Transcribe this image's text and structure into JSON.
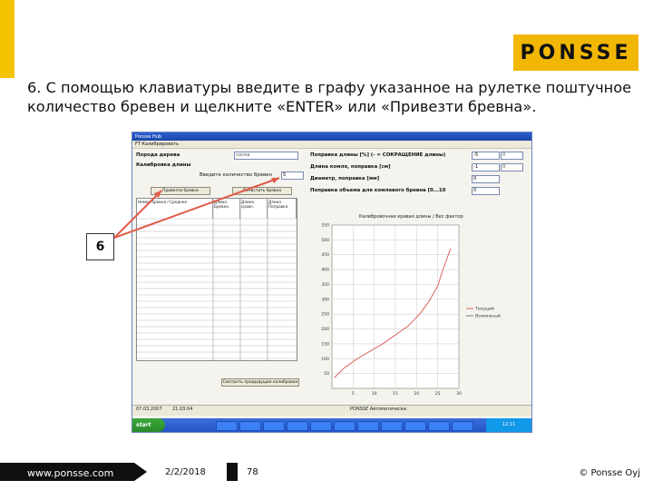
{
  "brand": {
    "logo_text": "PONSSE",
    "yellow": "#f2b705"
  },
  "instruction": "6. С помощью клавиатуры введите в графу указанное на рулетке поштучное количество бревен и щелкните «ENTER» или «Привезти бревна».",
  "callout_number": "6",
  "app": {
    "title": "Ponsse Hub",
    "menu": "FT  Калибрировать",
    "species_label": "Порода дерева",
    "species_value": "сосна",
    "calibration_label": "Калибровка длины",
    "count_prompt": "Введите количество бревен",
    "count_value": "5",
    "fetch_logs_button": "Привезти бревна",
    "clear_button": "Почистить бревна",
    "length_correction_label": "Поправка длины [%] (- = СОКРАЩЕНИЕ длины)",
    "length_correction_value": "-5",
    "length_correction_extra": "0",
    "butt_length_label": "Длина комля, поправка [см]",
    "butt_length_value": "-1",
    "butt_length_extra": "0",
    "diameter_label": "Диаметр, поправка [мм]",
    "diameter_value": "0",
    "volume_label": "Поправка объема для комлевого бревна [0...10",
    "volume_value": "0",
    "grid_headers": [
      "Номер бревна / Среднее",
      "Длина Бревна",
      "Длина сравн.",
      "Длина Поправка",
      "Длина Измерено"
    ],
    "history_button": "Смотреть предыдущие калибровки",
    "status": {
      "left": "07.03.2007",
      "mid": "21.03.04",
      "right": "PONSSE  Автоматически"
    },
    "taskbar_start": "start",
    "clock": "12:11"
  },
  "chart_data": {
    "type": "line",
    "title": "Калибровочная кривая длины / Вес фактор",
    "xlim": [
      0,
      30
    ],
    "ylim": [
      0,
      550
    ],
    "x_ticks": [
      "5",
      "10",
      "15",
      "20",
      "25",
      "30"
    ],
    "y_ticks": [
      "50",
      "100",
      "150",
      "200",
      "250",
      "300",
      "350",
      "400",
      "450",
      "500",
      "550"
    ],
    "legend": [
      "Текущий",
      "Возможный"
    ],
    "legend_position": "right",
    "series": [
      {
        "name": "Текущий",
        "color": "#d9534f",
        "x": [
          0.5,
          3,
          6,
          9,
          12,
          15,
          18,
          21,
          23,
          25,
          26,
          27,
          28
        ],
        "y": [
          35,
          70,
          100,
          125,
          150,
          180,
          210,
          255,
          295,
          345,
          390,
          430,
          470
        ]
      }
    ],
    "grid": true
  },
  "footer": {
    "site": "www.ponsse.com",
    "date": "2/2/2018",
    "page": "78",
    "copyright": "© Ponsse Oyj"
  }
}
